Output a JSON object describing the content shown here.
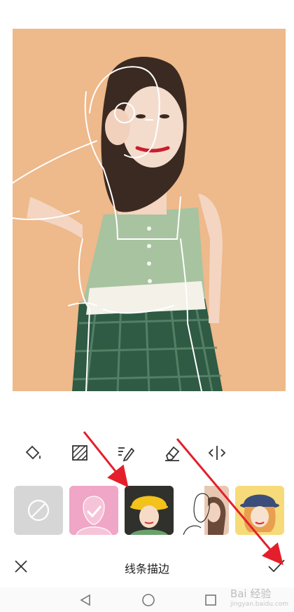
{
  "editor": {
    "title": "线条描边"
  },
  "toolbar": {
    "tools": [
      "fill-tool",
      "pattern-tool",
      "brush-tool",
      "eraser-tool",
      "compare-tool"
    ]
  },
  "styles": [
    {
      "name": "none"
    },
    {
      "name": "line-art-pink",
      "selected": true
    },
    {
      "name": "cartoon-yellow-hat"
    },
    {
      "name": "sketch-half"
    },
    {
      "name": "cartoon-bucket-hat"
    }
  ],
  "watermark": {
    "text": "Bai 经验",
    "subtext": "jingyan.baidu.com"
  },
  "colors": {
    "accent": "#e41f2b",
    "photo_bg": "#eeb98b",
    "thumb_selected": "#f2a3c5"
  }
}
